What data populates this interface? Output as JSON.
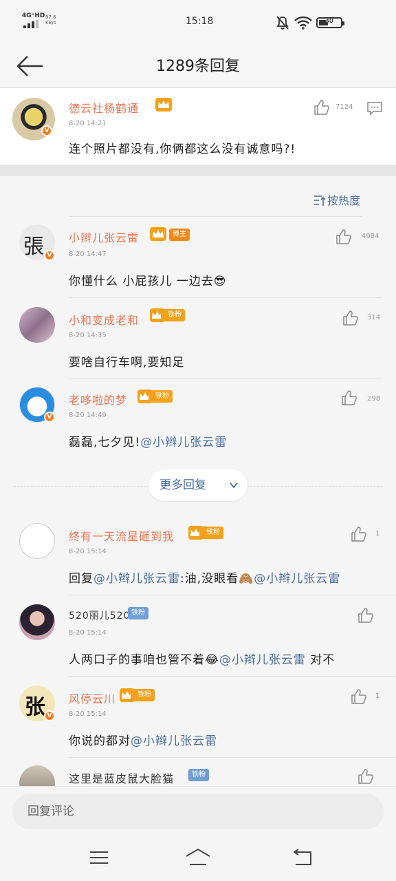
{
  "status_bar": {
    "network": "4G⁺HD",
    "speed_value": "97.6",
    "speed_unit": "KB/s",
    "time": "15:18",
    "battery": "40",
    "battery_level": 0.4
  },
  "header": {
    "title": "1289条回复"
  },
  "main_comment": {
    "author": "德云社杨鹤通",
    "time": "8-20 14:21",
    "text": "连个照片都没有,你俩都这么没有诚意吗?!",
    "likes": "7124"
  },
  "sort": {
    "label": "按热度"
  },
  "replies": [
    {
      "author": "小辫儿张云雷",
      "tag": "博主",
      "time": "8-20 14:47",
      "text": "你懂什么 小屁孩儿 一边去😎",
      "likes": "4984"
    },
    {
      "author": "小和变成老和",
      "tag": "铁粉",
      "time": "8-20 14:35",
      "text": "要啥自行车啊,要知足",
      "likes": "314"
    },
    {
      "author": "老哆啦的梦",
      "tag": "铁粉",
      "time": "8-20 14:49",
      "text_prefix": "磊磊,七夕见!",
      "mention": "@小辫儿张云雷",
      "likes": "298"
    },
    {
      "author": "终有一天流星砸到我",
      "tag": "铁粉",
      "time": "8-20 15:14",
      "text_prefix": "回复",
      "mention": "@小辫儿张云雷",
      "text_mid": ":油,没眼看🙈",
      "mention2": "@小辫儿张云雷",
      "likes": "1"
    },
    {
      "author": "520丽儿520",
      "tag": "铁粉",
      "time": "8-20 15:14",
      "text_prefix": "人两口子的事咱也管不着😂",
      "mention": "@小辫儿张云雷",
      "text_suffix": " 对不",
      "likes": ""
    },
    {
      "author": "风停云川",
      "tag": "铁粉",
      "time": "8-20 15:14",
      "text_prefix": "你说的都对",
      "mention": "@小辫儿张云雷",
      "likes": "1"
    },
    {
      "author": "这里是蓝皮鼠大脸猫",
      "tag": "铁粉",
      "likes": ""
    }
  ],
  "more_replies": {
    "label": "更多回复"
  },
  "reply_input": {
    "placeholder": "回复评论"
  },
  "icons": {
    "back": "arrow-left-icon",
    "like": "thumbs-up-icon",
    "comment": "comment-icon",
    "sort": "sort-icon",
    "crown": "crown-icon",
    "chevron": "chevron-down-icon",
    "menu": "menu-icon",
    "home": "home-icon",
    "return": "return-icon"
  },
  "colors": {
    "name_accent": "#eb7350",
    "mention": "#4a6f9e",
    "tag_orange": "#ef8a1a",
    "tag_blue": "#6f9ed8"
  }
}
